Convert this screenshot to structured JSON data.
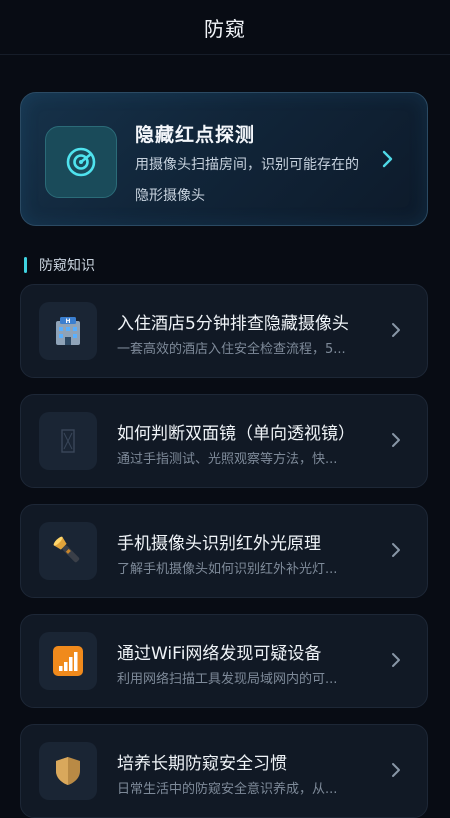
{
  "header": {
    "title": "防窥"
  },
  "hero": {
    "title": "隐藏红点探测",
    "description": "用摄像头扫描房间，识别可能存在的隐形摄像头",
    "icon": "radar-scan-icon"
  },
  "section": {
    "title": "防窥知识"
  },
  "articles": [
    {
      "title": "入住酒店5分钟排查隐藏摄像头",
      "description": "一套高效的酒店入住安全检查流程，5...",
      "icon": "hotel-icon"
    },
    {
      "title": "如何判断双面镜（单向透视镜）",
      "description": "通过手指测试、光照观察等方法，快...",
      "icon": "mirror-icon"
    },
    {
      "title": "手机摄像头识别红外光原理",
      "description": "了解手机摄像头如何识别红外补光灯...",
      "icon": "flashlight-icon"
    },
    {
      "title": "通过WiFi网络发现可疑设备",
      "description": "利用网络扫描工具发现局域网内的可...",
      "icon": "signal-bars-icon"
    },
    {
      "title": "培养长期防窥安全习惯",
      "description": "日常生活中的防窥安全意识养成，从...",
      "icon": "shield-icon"
    }
  ],
  "colors": {
    "accent": "#3fd3e0",
    "background": "#080c14",
    "card": "#111925"
  }
}
